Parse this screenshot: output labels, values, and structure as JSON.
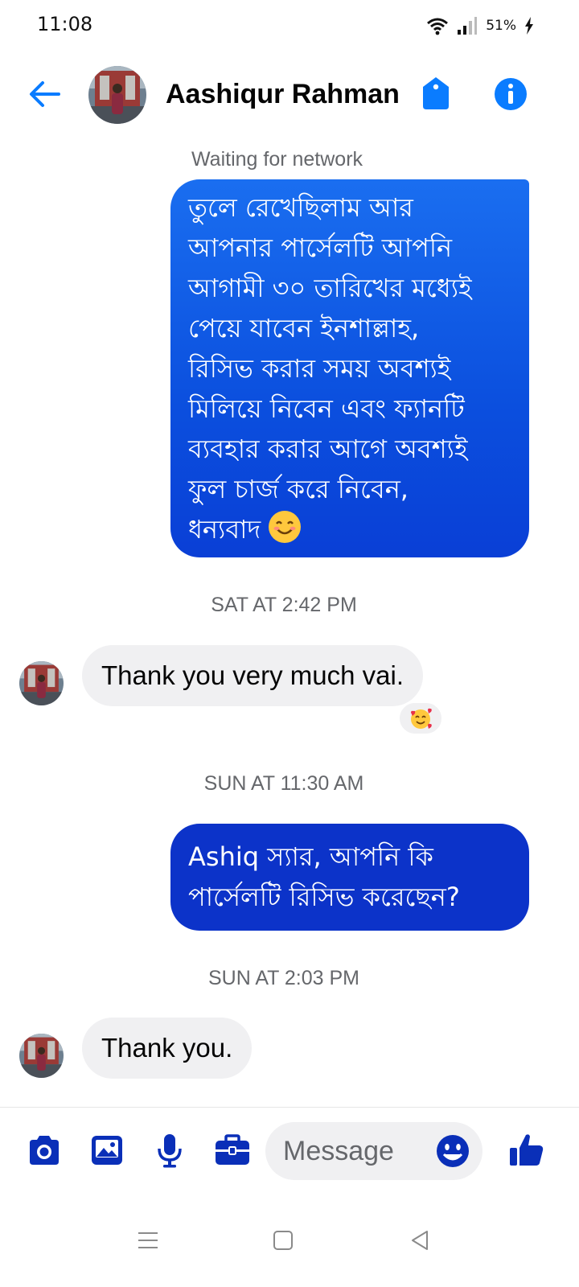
{
  "status_bar": {
    "time": "11:08",
    "battery": "51%"
  },
  "header": {
    "contact_name": "Aashiqur Rahman"
  },
  "chat": {
    "status_note": "Waiting for network",
    "out_message_1": {
      "lines": [
        "তুলে রেখেছিলাম আর",
        "আপনার পার্সেলটি আপনি",
        "আগামী ৩০ তারিখের মধ্যেই",
        "পেয়ে যাবেন ইনশাল্লাহ,",
        "রিসিভ করার সময় অবশ্যই",
        "মিলিয়ে নিবেন এবং ফ্যানটি",
        "ব্যবহার করার আগে অবশ্যই",
        "ফুল চার্জ করে নিবেন,",
        "ধন্যবাদ"
      ],
      "emoji": "smiling-face-emoji"
    },
    "timestamp_1": "SAT AT 2:42 PM",
    "in_message_1": "Thank you very much vai.",
    "reaction_1": "smiling-face-with-hearts-emoji",
    "timestamp_2": "SUN AT 11:30 AM",
    "out_message_2": {
      "lines": [
        "Ashiq স্যার, আপনি কি",
        "পার্সেলটি রিসিভ করেছেন?"
      ]
    },
    "timestamp_3": "SUN AT 2:03 PM",
    "in_message_2": "Thank you."
  },
  "composer": {
    "placeholder": "Message",
    "tools": [
      "camera-icon",
      "gallery-icon",
      "microphone-icon",
      "briefcase-icon"
    ]
  },
  "colors": {
    "accent": "#0a7cff",
    "tool_blue": "#0a2fb8",
    "bubble_out_1": "#1a6ef0",
    "bubble_out_2": "#0c33c9",
    "bubble_in": "#f0f0f2"
  }
}
